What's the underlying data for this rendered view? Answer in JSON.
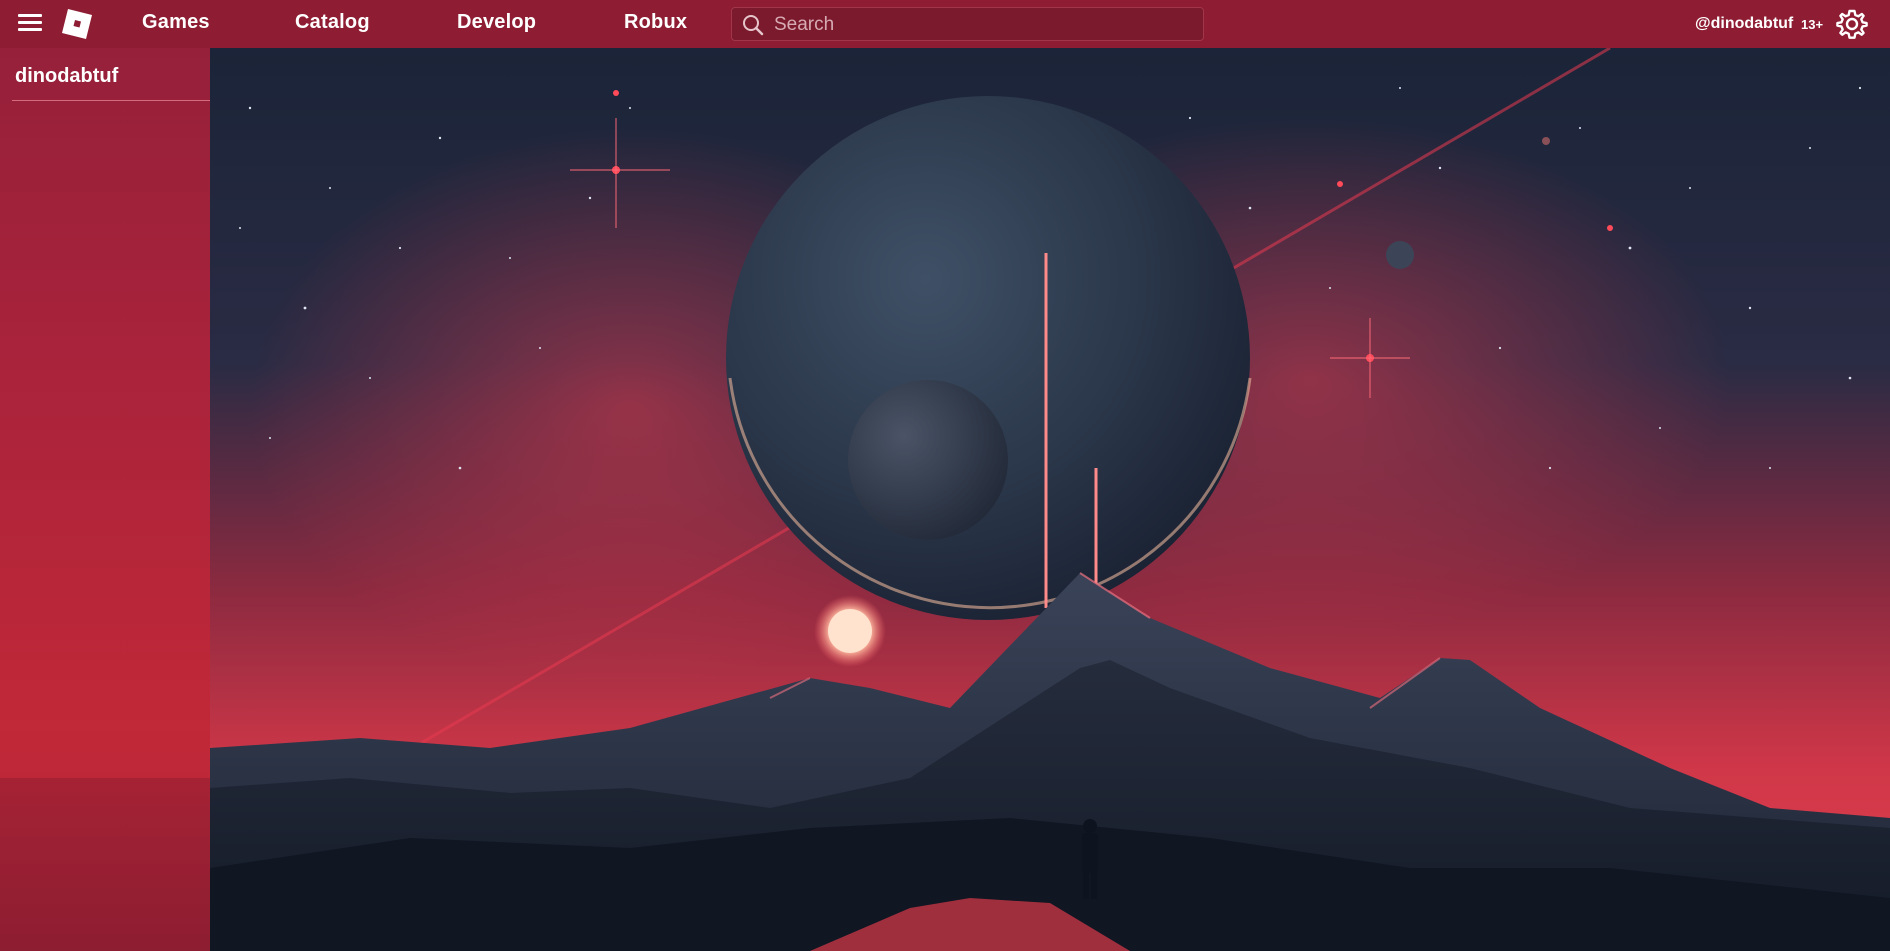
{
  "topbar": {
    "menu_icon": "hamburger-menu-icon",
    "logo": "roblox-logo",
    "nav": [
      {
        "label": "Games"
      },
      {
        "label": "Catalog"
      },
      {
        "label": "Develop"
      },
      {
        "label": "Robux"
      }
    ],
    "search": {
      "placeholder": "Search",
      "value": ""
    },
    "username": "@dinodabtuf",
    "age_badge": "13+",
    "settings_icon": "gear-icon"
  },
  "sidebar": {
    "username": "dinodabtuf"
  },
  "colors": {
    "topbar_bg": "#8e1c32",
    "sidebar_bg": "#b32538",
    "accent": "#e8344a"
  }
}
